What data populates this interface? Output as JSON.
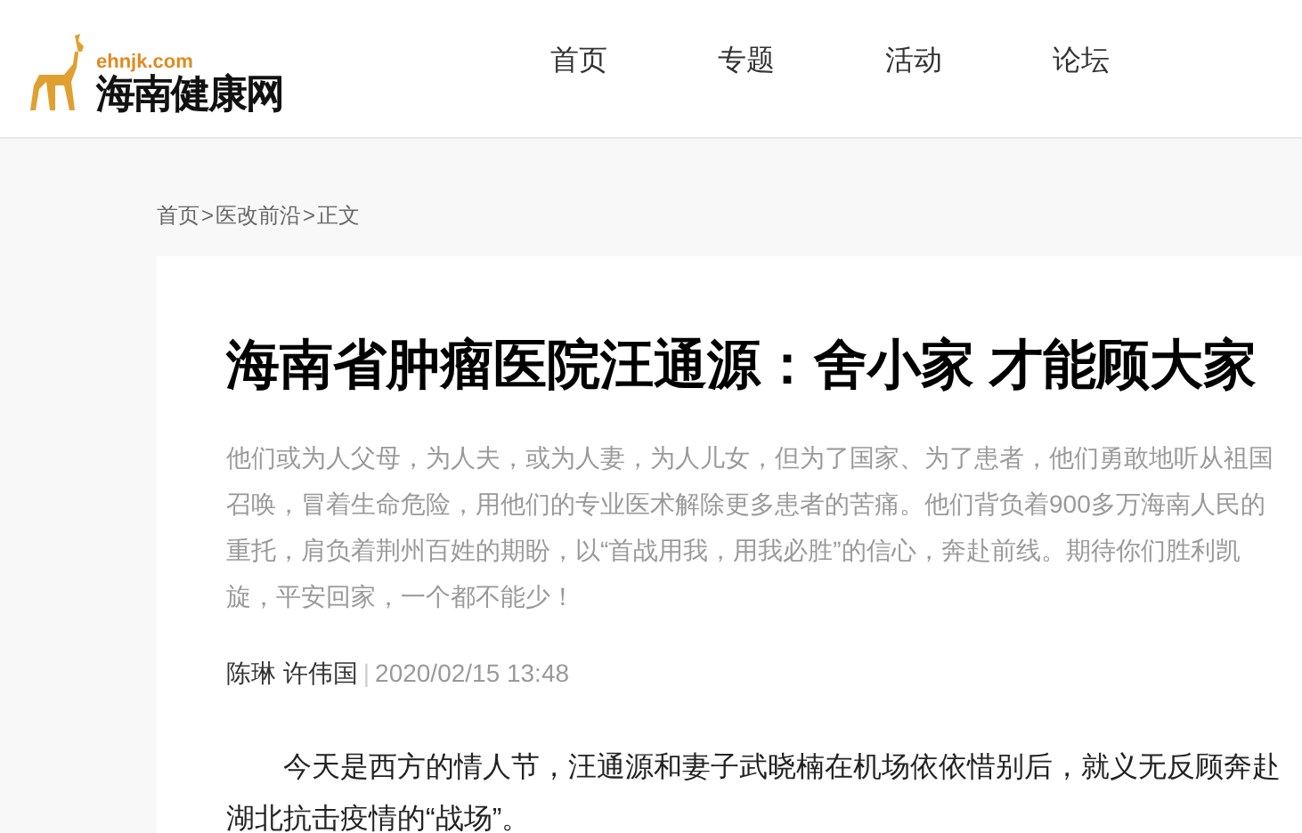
{
  "logo": {
    "domain": "ehnjk.com",
    "name": "海南健康网"
  },
  "nav": [
    {
      "label": "首页"
    },
    {
      "label": "专题"
    },
    {
      "label": "活动"
    },
    {
      "label": "论坛"
    }
  ],
  "breadcrumb": {
    "items": [
      "首页",
      "医改前沿",
      "正文"
    ],
    "separator": ">"
  },
  "article": {
    "title": "海南省肿瘤医院汪通源：舍小家 才能顾大家",
    "summary": "他们或为人父母，为人夫，或为人妻，为人儿女，但为了国家、为了患者，他们勇敢地听从祖国召唤，冒着生命危险，用他们的专业医术解除更多患者的苦痛。他们背负着900多万海南人民的重托，肩负着荆州百姓的期盼，以“首战用我，用我必胜”的信心，奔赴前线。期待你们胜利凯旋，平安回家，一个都不能少！",
    "authors": "陈琳 许伟国",
    "separator": "|",
    "date": "2020/02/15 13:48",
    "body": "今天是西方的情人节，汪通源和妻子武晓楠在机场依依惜别后，就义无反顾奔赴湖北抗击疫情的“战场”。"
  }
}
